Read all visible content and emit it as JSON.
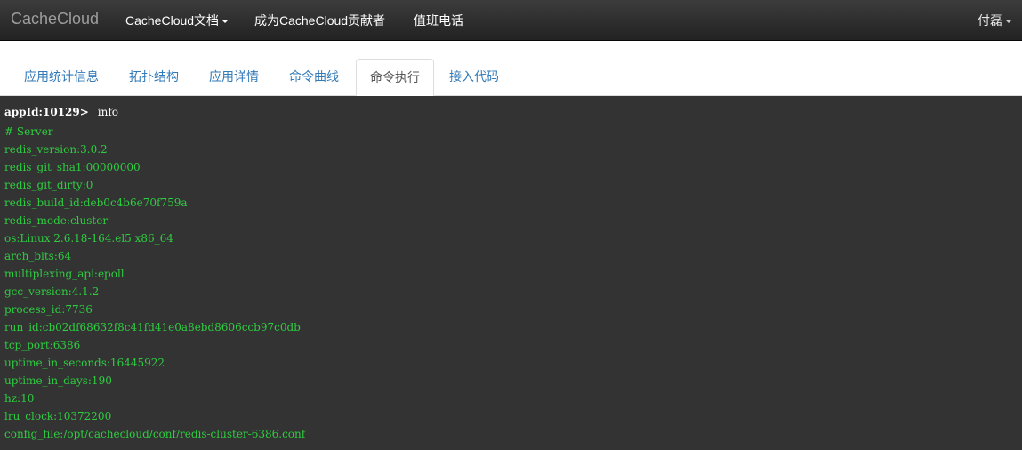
{
  "navbar": {
    "brand": "CacheCloud",
    "items": [
      {
        "label": "CacheCloud文档",
        "dropdown": true
      },
      {
        "label": "成为CacheCloud贡献者",
        "dropdown": false
      },
      {
        "label": "值班电话",
        "dropdown": false
      }
    ],
    "user": "付磊"
  },
  "tabs": {
    "items": [
      {
        "label": "应用统计信息",
        "active": false
      },
      {
        "label": "拓扑结构",
        "active": false
      },
      {
        "label": "应用详情",
        "active": false
      },
      {
        "label": "命令曲线",
        "active": false
      },
      {
        "label": "命令执行",
        "active": true
      },
      {
        "label": "接入代码",
        "active": false
      }
    ]
  },
  "console": {
    "prompt": "appId:10129>",
    "command": "info",
    "lines": [
      "# Server",
      "redis_version:3.0.2",
      "redis_git_sha1:00000000",
      "redis_git_dirty:0",
      "redis_build_id:deb0c4b6e70f759a",
      "redis_mode:cluster",
      "os:Linux 2.6.18-164.el5 x86_64",
      "arch_bits:64",
      "multiplexing_api:epoll",
      "gcc_version:4.1.2",
      "process_id:7736",
      "run_id:cb02df68632f8c41fd41e0a8ebd8606ccb97c0db",
      "tcp_port:6386",
      "uptime_in_seconds:16445922",
      "uptime_in_days:190",
      "hz:10",
      "lru_clock:10372200",
      "config_file:/opt/cachecloud/conf/redis-cluster-6386.conf"
    ],
    "colors": {
      "background": "#333333",
      "output": "#2ecc40",
      "prompt": "#ffffff"
    }
  }
}
